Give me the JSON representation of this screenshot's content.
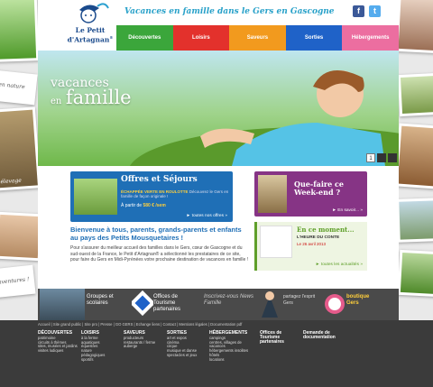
{
  "header": {
    "logo_line1": "Le Petit",
    "logo_line2": "d'Artagnan",
    "logo_tm": "®",
    "tagline": "Vacances en famille dans le Gers en Gascogne"
  },
  "social": [
    {
      "name": "facebook",
      "glyph": "f",
      "color": "#3b5998"
    },
    {
      "name": "twitter",
      "glyph": "t",
      "color": "#55acee"
    }
  ],
  "nav": [
    {
      "label": "Découvertes",
      "color": "#3ba63b"
    },
    {
      "label": "Loisirs",
      "color": "#e3312c"
    },
    {
      "label": "Saveurs",
      "color": "#f29a1e"
    },
    {
      "label": "Sorties",
      "color": "#1f62c8"
    },
    {
      "label": "Hébergements",
      "color": "#ec6ea0"
    }
  ],
  "hero": {
    "title_line1": "vacances",
    "title_line2": "en",
    "title_big": "famille",
    "pager": [
      "1",
      "",
      ""
    ]
  },
  "side_captions": {
    "left_top": "en nature",
    "left_mid": "élevage",
    "left_bottom": "aventures !"
  },
  "offres": {
    "title": "Offres et Séjours",
    "desc_label": "ÉCHAPPÉE VERTE EN ROULOTTE",
    "desc": "Découvrez le Gers en famille de façon originale !",
    "price_prefix": "À partir de",
    "price": "580 € /sem",
    "link": "► toutes nos offres »"
  },
  "weekend": {
    "title": "Que-faire ce Week-end ?",
    "link": "► En savoir... »"
  },
  "news": {
    "title": "En ce moment...",
    "item": "L'HEURE DU CONTE",
    "date": "Le 26 avril 2013",
    "link": "► toutes les actualités »"
  },
  "welcome": {
    "title": "Bienvenue à tous, parents, grands-parents et enfants au pays des Petits Mousquetaires !",
    "text": "Pour s'assurer du meilleur accueil des familles dans le Gers, cœur de Gascogne et du sud-ouest de la France, le Petit d'Artagnan® a sélectionné les prestataires de ce site, pour faire du Gers en Midi-Pyrénées votre prochaine destination de vacances en famille !"
  },
  "strip": {
    "groupes": "Groupes et scolaires",
    "offices": "Offices de Tourisme partenaires",
    "newsletter": "Inscrivez-vous News Famille",
    "partagez": "partagez l'esprit Gers",
    "boutique": "boutique Gers"
  },
  "footer": {
    "links": "Accueil | Site grand public | Site pro | Presse | GO GERS | Echange liens | Contact | Mentions légales | Documentation pdf",
    "columns": [
      {
        "h": "DÉCOUVERTES",
        "items": [
          "patrimoine",
          "circuits à thèmes",
          "sites, musées et jardins",
          "visites ludiques"
        ]
      },
      {
        "h": "LOISIRS",
        "items": [
          "à la ferme",
          "aquatiques",
          "équestres",
          "nature",
          "pédagogiques",
          "sportifs"
        ]
      },
      {
        "h": "SAVEURS",
        "items": [
          "producteurs",
          "restaurants / ferme",
          "auberge"
        ]
      },
      {
        "h": "SORTIES",
        "items": [
          "art et expos",
          "cinéma",
          "cirque",
          "musique et danse",
          "spectacles et jeux"
        ]
      },
      {
        "h": "HÉBERGEMENTS",
        "items": [
          "campings",
          "centres, villages de vacances",
          "hébergements insolites",
          "hôtels",
          "locations"
        ]
      },
      {
        "h": "Offices de Tourisme partenaires",
        "items": []
      },
      {
        "h": "Demande de documentation",
        "items": []
      }
    ]
  }
}
